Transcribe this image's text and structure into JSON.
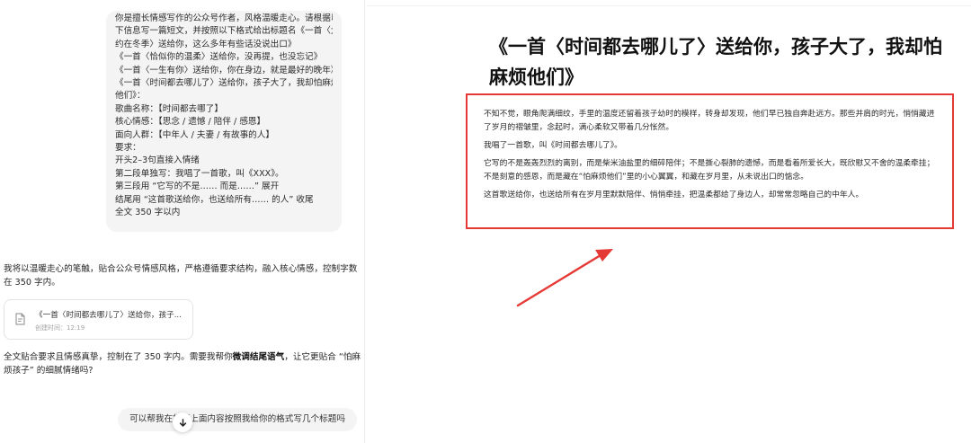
{
  "chat": {
    "user_prompt_lines": [
      "你是擅长情感写作的公众号作者，风格温暖走心。请根据以",
      "下信息写一篇短文，并按照以下格式给出标题名《一首〈大",
      "约在冬季〉送给你，这么多年有些话没说出口》",
      "《一首〈恰似你的温柔〉送给你，没再提，也没忘记》",
      "《一首〈一生有你〉送给你，你在身边，就是最好的晚年》",
      "《一首〈时间都去哪儿了〉送给你，孩子大了，我却怕麻烦",
      "他们》：",
      "歌曲名称：【时间都去哪了】",
      "核心情感：【思念 / 遗憾 / 陪伴 / 感恩】",
      "面向人群：【中年人 / 夫妻 / 有故事的人】",
      "要求：",
      "开头2–3句直接入情绪",
      "第二段单独写：我唱了一首歌，叫《XXX》。",
      "第三段用 “它写的不是…… 而是……” 展开",
      "结尾用 “这首歌送给你，也送给所有…… 的人” 收尾",
      "全文 350 字以内"
    ],
    "assistant_intro": "我将以温暖走心的笔触，贴合公众号情感风格，严格遵循要求结构，融入核心情感，控制字数在 350 字内。",
    "doc_card": {
      "title": "《一首〈时间都去哪儿了〉送给你，孩子...",
      "created_label": "创建时间：12:19",
      "icon": "document-icon"
    },
    "assistant_outro_before": "全文贴合要求且情感真挚，控制在了 350 字内。需要我帮你",
    "assistant_outro_bold": "微调结尾语气",
    "assistant_outro_after": "，让它更贴合 “怕麻烦孩子” 的细腻情绪吗?",
    "suggestion": "可以帮我在根据上面内容按照我给你的格式写几个标题吗",
    "scroll_icon": "arrow-down-icon"
  },
  "document": {
    "heading": "《一首〈时间都去哪儿了〉送给你，孩子大了，我却怕麻烦他们》",
    "paragraphs": [
      "不知不觉，眼角爬满细纹，手里的温度还留着孩子幼时的模样，转身却发现，他们早已独自奔赴远方。那些并肩的时光，悄悄藏进了岁月的褶皱里，念起时，满心柔软又带着几分怅然。",
      "我唱了一首歌，叫《时间都去哪儿了》。",
      "它写的不是轰轰烈烈的离别，而是柴米油盐里的细碎陪伴；不是撕心裂肺的遗憾，而是看着所爱长大，既欣慰又不舍的温柔牵挂；不是刻意的感恩，而是藏在“怕麻烦他们”里的小心翼翼，和藏在岁月里，从未说出口的惦念。",
      "这首歌送给你，也送给所有在岁月里默默陪伴、悄悄牵挂，把温柔都给了身边人，却常常忽略自己的中年人。"
    ]
  },
  "colors": {
    "highlight_border": "#e53935",
    "arrow": "#e53935",
    "bubble_bg": "#f4f4f5"
  }
}
